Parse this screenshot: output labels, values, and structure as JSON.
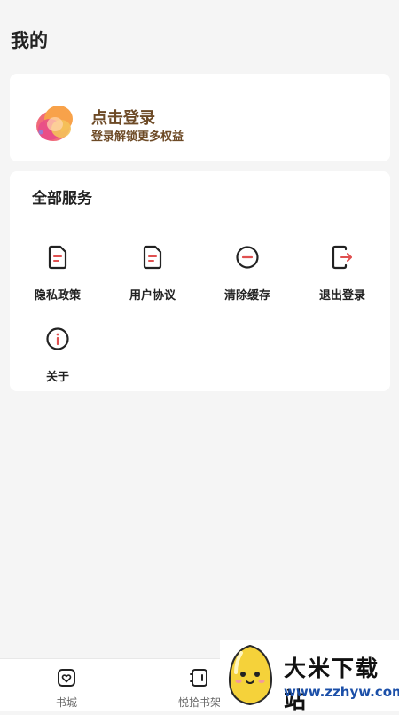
{
  "header": {
    "title": "我的"
  },
  "login": {
    "title": "点击登录",
    "subtitle": "登录解锁更多权益"
  },
  "services": {
    "title": "全部服务",
    "items": [
      {
        "label": "隐私政策",
        "icon": "document-icon"
      },
      {
        "label": "用户协议",
        "icon": "document-icon"
      },
      {
        "label": "清除缓存",
        "icon": "minus-circle-icon"
      },
      {
        "label": "退出登录",
        "icon": "logout-icon"
      },
      {
        "label": "关于",
        "icon": "info-circle-icon"
      }
    ]
  },
  "tabbar": {
    "tabs": [
      {
        "label": "书城",
        "icon": "bookstore-heart-icon"
      },
      {
        "label": "悦拾书架",
        "icon": "bookshelf-icon"
      }
    ]
  },
  "watermark": {
    "title": "大米下载站",
    "url": "www.zzhyw.com"
  },
  "colors": {
    "background": "#f5f5f5",
    "card": "#ffffff",
    "login_text": "#6d4a26",
    "accent_red": "#e05050"
  }
}
